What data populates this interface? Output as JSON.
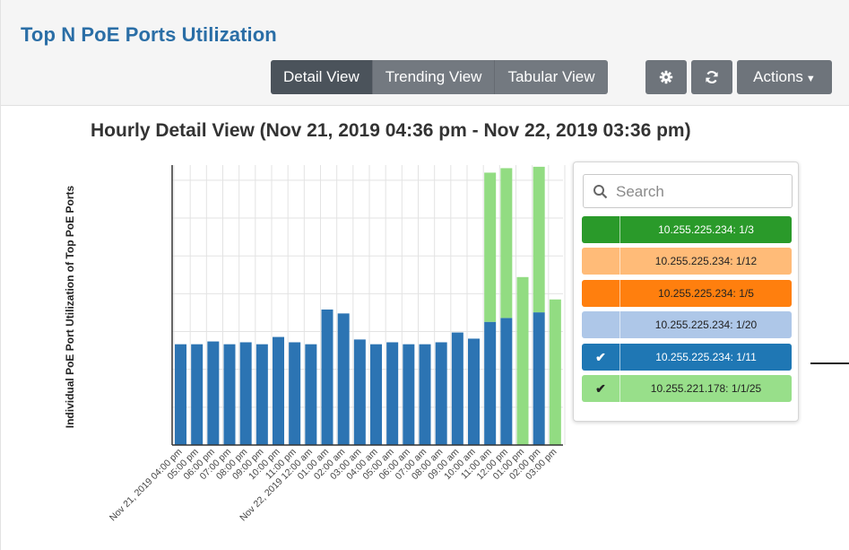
{
  "panel": {
    "title": "Top N PoE Ports Utilization"
  },
  "toolbar": {
    "views": [
      {
        "label": "Detail View",
        "active": true
      },
      {
        "label": "Trending View",
        "active": false
      },
      {
        "label": "Tabular View",
        "active": false
      }
    ],
    "settings_icon": "gear-icon",
    "refresh_icon": "refresh-icon",
    "actions_label": "Actions"
  },
  "legend": {
    "search_placeholder": "Search",
    "items": [
      {
        "label": "10.255.225.234: 1/3",
        "color": "#2a9a2a",
        "checked": false
      },
      {
        "label": "10.255.225.234: 1/12",
        "color": "#ffbb78",
        "checked": false
      },
      {
        "label": "10.255.225.234: 1/5",
        "color": "#ff7f0e",
        "checked": false
      },
      {
        "label": "10.255.225.234: 1/20",
        "color": "#aec7e8",
        "checked": false
      },
      {
        "label": "10.255.225.234: 1/11",
        "color": "#1f77b4",
        "checked": true
      },
      {
        "label": "10.255.221.178: 1/1/25",
        "color": "#98df8a",
        "checked": true
      }
    ]
  },
  "chart_data": {
    "type": "bar",
    "stacked": true,
    "title": "Hourly Detail View (Nov 21, 2019 04:36 pm - Nov 22, 2019 03:36 pm)",
    "xlabel": "",
    "ylabel": "Individual PoE Port Utilization of Top PoE Ports",
    "y_tick_labels_shown": false,
    "grid": true,
    "ylim": [
      0,
      1
    ],
    "categories": [
      "Nov 21, 2019 04:00 pm",
      "05:00 pm",
      "06:00 pm",
      "07:00 pm",
      "08:00 pm",
      "09:00 pm",
      "10:00 pm",
      "11:00 pm",
      "Nov 22, 2019 12:00 am",
      "01:00 am",
      "02:00 am",
      "03:00 am",
      "04:00 am",
      "05:00 am",
      "06:00 am",
      "07:00 am",
      "08:00 am",
      "09:00 am",
      "10:00 am",
      "11:00 am",
      "12:00 pm",
      "01:00 pm",
      "02:00 pm",
      "03:00 pm"
    ],
    "series": [
      {
        "name": "10.255.225.234: 1/11",
        "color": "#2c74b3",
        "values": [
          0.36,
          0.36,
          0.37,
          0.36,
          0.367,
          0.36,
          0.386,
          0.367,
          0.36,
          0.484,
          0.47,
          0.377,
          0.36,
          0.367,
          0.36,
          0.36,
          0.367,
          0.402,
          0.38,
          0.44,
          0.454,
          0,
          0.474,
          0
        ]
      },
      {
        "name": "10.255.221.178: 1/1/25",
        "color": "#92dc82",
        "values": [
          0,
          0,
          0,
          0,
          0,
          0,
          0,
          0,
          0,
          0,
          0,
          0,
          0,
          0,
          0,
          0,
          0,
          0,
          0,
          0.533,
          0.535,
          0.6,
          0.52,
          0.52
        ]
      }
    ]
  }
}
